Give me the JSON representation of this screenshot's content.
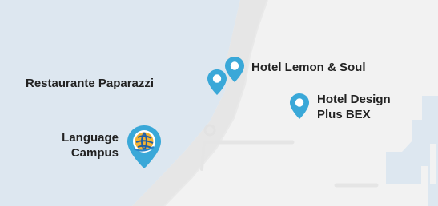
{
  "map": {
    "colors": {
      "water": "#dde7f0",
      "land": "#f2f2f2",
      "beach": "#e6e6e6",
      "pin": "#3aa8d8",
      "text": "#222222"
    },
    "markers": [
      {
        "id": "restaurante-paparazzi",
        "label": "Restaurante Paparazzi",
        "icon": "map-pin-icon"
      },
      {
        "id": "hotel-lemon-soul",
        "label": "Hotel Lemon & Soul",
        "icon": "map-pin-icon"
      },
      {
        "id": "hotel-design-plus-bex",
        "label_line1": "Hotel Design",
        "label_line2": "Plus BEX",
        "icon": "map-pin-icon"
      },
      {
        "id": "language-campus",
        "label_line1": "Language",
        "label_line2": "Campus",
        "icon": "globe-logo-pin-icon"
      }
    ]
  }
}
